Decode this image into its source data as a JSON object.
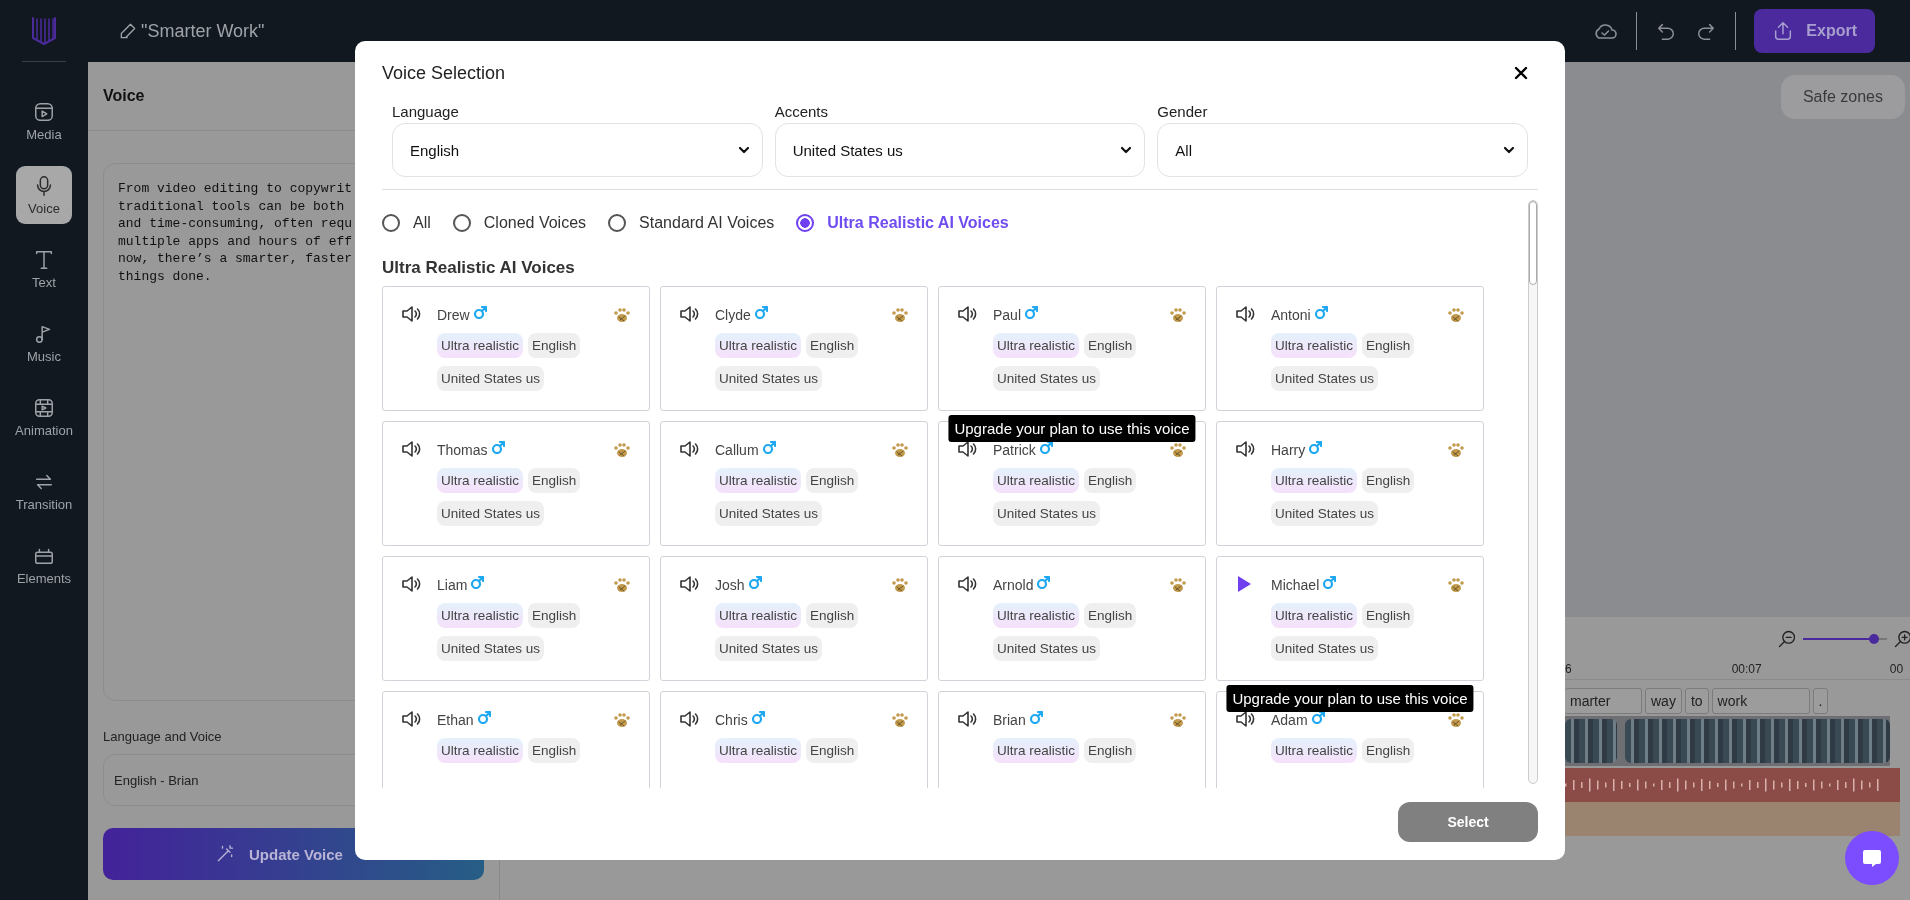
{
  "app": {
    "title": "\"Smarter Work\"",
    "export_label": "Export"
  },
  "sidebar": {
    "items": [
      {
        "label": "Media",
        "selected": false
      },
      {
        "label": "Voice",
        "selected": true
      },
      {
        "label": "Text",
        "selected": false
      },
      {
        "label": "Music",
        "selected": false
      },
      {
        "label": "Animation",
        "selected": false
      },
      {
        "label": "Transition",
        "selected": false
      },
      {
        "label": "Elements",
        "selected": false
      }
    ]
  },
  "voice_panel": {
    "title": "Voice",
    "script": "From video editing to copywrit\ntraditional tools can be both\nand time-consuming, often requ\nmultiple apps and hours of eff\nnow, there’s a smarter, faster\nthings done.",
    "language_voice_label": "Language and Voice",
    "language_voice_value": "English - Brian",
    "update_button": "Update Voice"
  },
  "preview": {
    "safe_zones": "Safe zones"
  },
  "timeline": {
    "zoom": {
      "level": 0.85
    },
    "time_labels": [
      "6",
      "00:07",
      "00"
    ],
    "captions": [
      "marter",
      "way",
      "to",
      "work",
      "."
    ]
  },
  "modal": {
    "title": "Voice Selection",
    "filters": [
      {
        "label": "Language",
        "value": "English"
      },
      {
        "label": "Accents",
        "value": "United States us"
      },
      {
        "label": "Gender",
        "value": "All"
      }
    ],
    "radios": [
      {
        "label": "All",
        "selected": false
      },
      {
        "label": "Cloned Voices",
        "selected": false
      },
      {
        "label": "Standard AI Voices",
        "selected": false
      },
      {
        "label": "Ultra Realistic AI Voices",
        "selected": true
      }
    ],
    "section_title": "Ultra Realistic AI Voices",
    "voices": [
      {
        "name": "Drew",
        "playing": false,
        "tags": [
          "Ultra realistic",
          "English",
          "United States us"
        ]
      },
      {
        "name": "Clyde",
        "playing": false,
        "tags": [
          "Ultra realistic",
          "English",
          "United States us"
        ]
      },
      {
        "name": "Paul",
        "playing": false,
        "tags": [
          "Ultra realistic",
          "English",
          "United States us"
        ],
        "tooltip": "Upgrade your plan to use this voice"
      },
      {
        "name": "Antoni",
        "playing": false,
        "tags": [
          "Ultra realistic",
          "English",
          "United States us"
        ]
      },
      {
        "name": "Thomas",
        "playing": false,
        "tags": [
          "Ultra realistic",
          "English",
          "United States us"
        ]
      },
      {
        "name": "Callum",
        "playing": false,
        "tags": [
          "Ultra realistic",
          "English",
          "United States us"
        ]
      },
      {
        "name": "Patrick",
        "playing": false,
        "tags": [
          "Ultra realistic",
          "English",
          "United States us"
        ]
      },
      {
        "name": "Harry",
        "playing": false,
        "tags": [
          "Ultra realistic",
          "English",
          "United States us"
        ]
      },
      {
        "name": "Liam",
        "playing": false,
        "tags": [
          "Ultra realistic",
          "English",
          "United States us"
        ]
      },
      {
        "name": "Josh",
        "playing": false,
        "tags": [
          "Ultra realistic",
          "English",
          "United States us"
        ]
      },
      {
        "name": "Arnold",
        "playing": false,
        "tags": [
          "Ultra realistic",
          "English",
          "United States us"
        ]
      },
      {
        "name": "Michael",
        "playing": true,
        "tags": [
          "Ultra realistic",
          "English",
          "United States us"
        ],
        "tooltip": "Upgrade your plan to use this voice"
      },
      {
        "name": "Ethan",
        "playing": false,
        "tags": [
          "Ultra realistic",
          "English"
        ]
      },
      {
        "name": "Chris",
        "playing": false,
        "tags": [
          "Ultra realistic",
          "English"
        ]
      },
      {
        "name": "Brian",
        "playing": false,
        "tags": [
          "Ultra realistic",
          "English"
        ]
      },
      {
        "name": "Adam",
        "playing": false,
        "tags": [
          "Ultra realistic",
          "English"
        ]
      }
    ],
    "select_button": "Select"
  }
}
